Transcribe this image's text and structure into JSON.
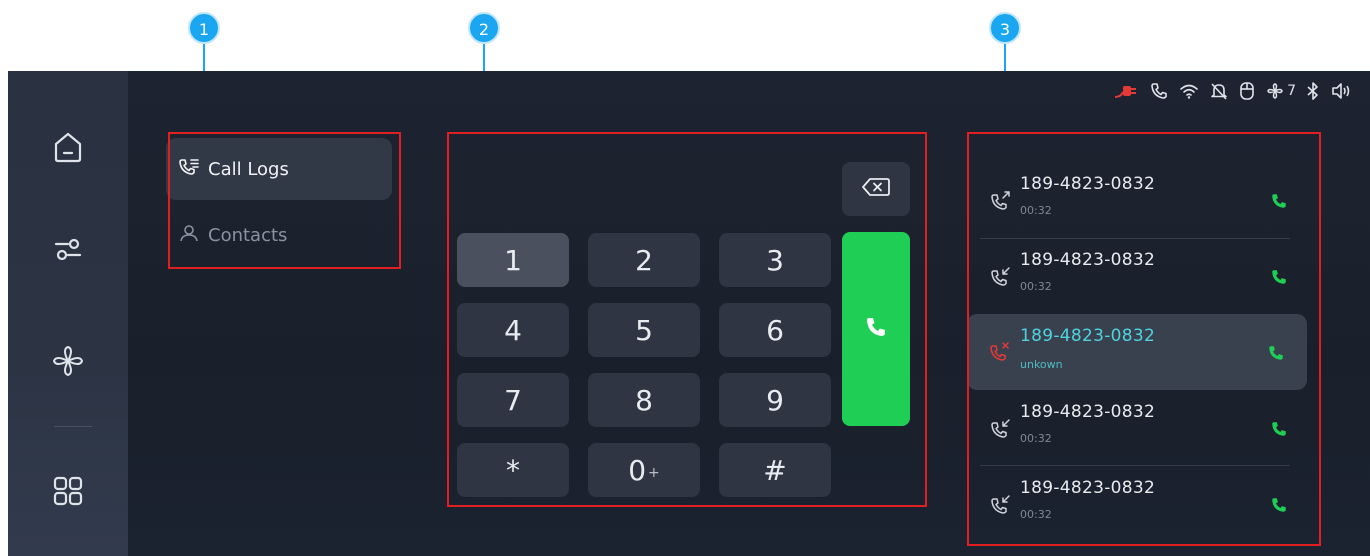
{
  "callouts": [
    "1",
    "2",
    "3"
  ],
  "status_bar": {
    "icons": [
      "plug-icon",
      "phone-icon",
      "wifi-icon",
      "bell-off-icon",
      "mouse-icon",
      "fan-icon",
      "bluetooth-icon",
      "volume-icon"
    ],
    "fan_level": "7",
    "plug_color": "#e53935"
  },
  "sidebar": {
    "items": [
      {
        "name": "home",
        "icon": "home-icon"
      },
      {
        "name": "settings",
        "icon": "sliders-icon"
      },
      {
        "name": "climate",
        "icon": "fan-icon"
      },
      {
        "name": "apps",
        "icon": "apps-grid-icon"
      }
    ]
  },
  "nav": {
    "call_logs": "Call Logs",
    "contacts": "Contacts"
  },
  "keypad": {
    "keys": [
      "1",
      "2",
      "3",
      "4",
      "5",
      "6",
      "7",
      "8",
      "9",
      "*",
      "0",
      "#"
    ],
    "zero_sub": "+",
    "pressed_key": "1",
    "call_color": "#1fcf55"
  },
  "call_logs": [
    {
      "number": "189-4823-0832",
      "sub": "00:32",
      "type": "outgoing"
    },
    {
      "number": "189-4823-0832",
      "sub": "00:32",
      "type": "incoming"
    },
    {
      "number": "189-4823-0832",
      "sub": "unkown",
      "type": "missed",
      "selected": true
    },
    {
      "number": "189-4823-0832",
      "sub": "00:32",
      "type": "incoming"
    },
    {
      "number": "189-4823-0832",
      "sub": "00:32",
      "type": "incoming"
    }
  ],
  "colors": {
    "accent_cyan": "#4fd3e0",
    "missed_red": "#e53935",
    "call_green": "#1fcf55",
    "annotation_blue": "#1aa6f0",
    "annotation_red": "#e02020"
  }
}
